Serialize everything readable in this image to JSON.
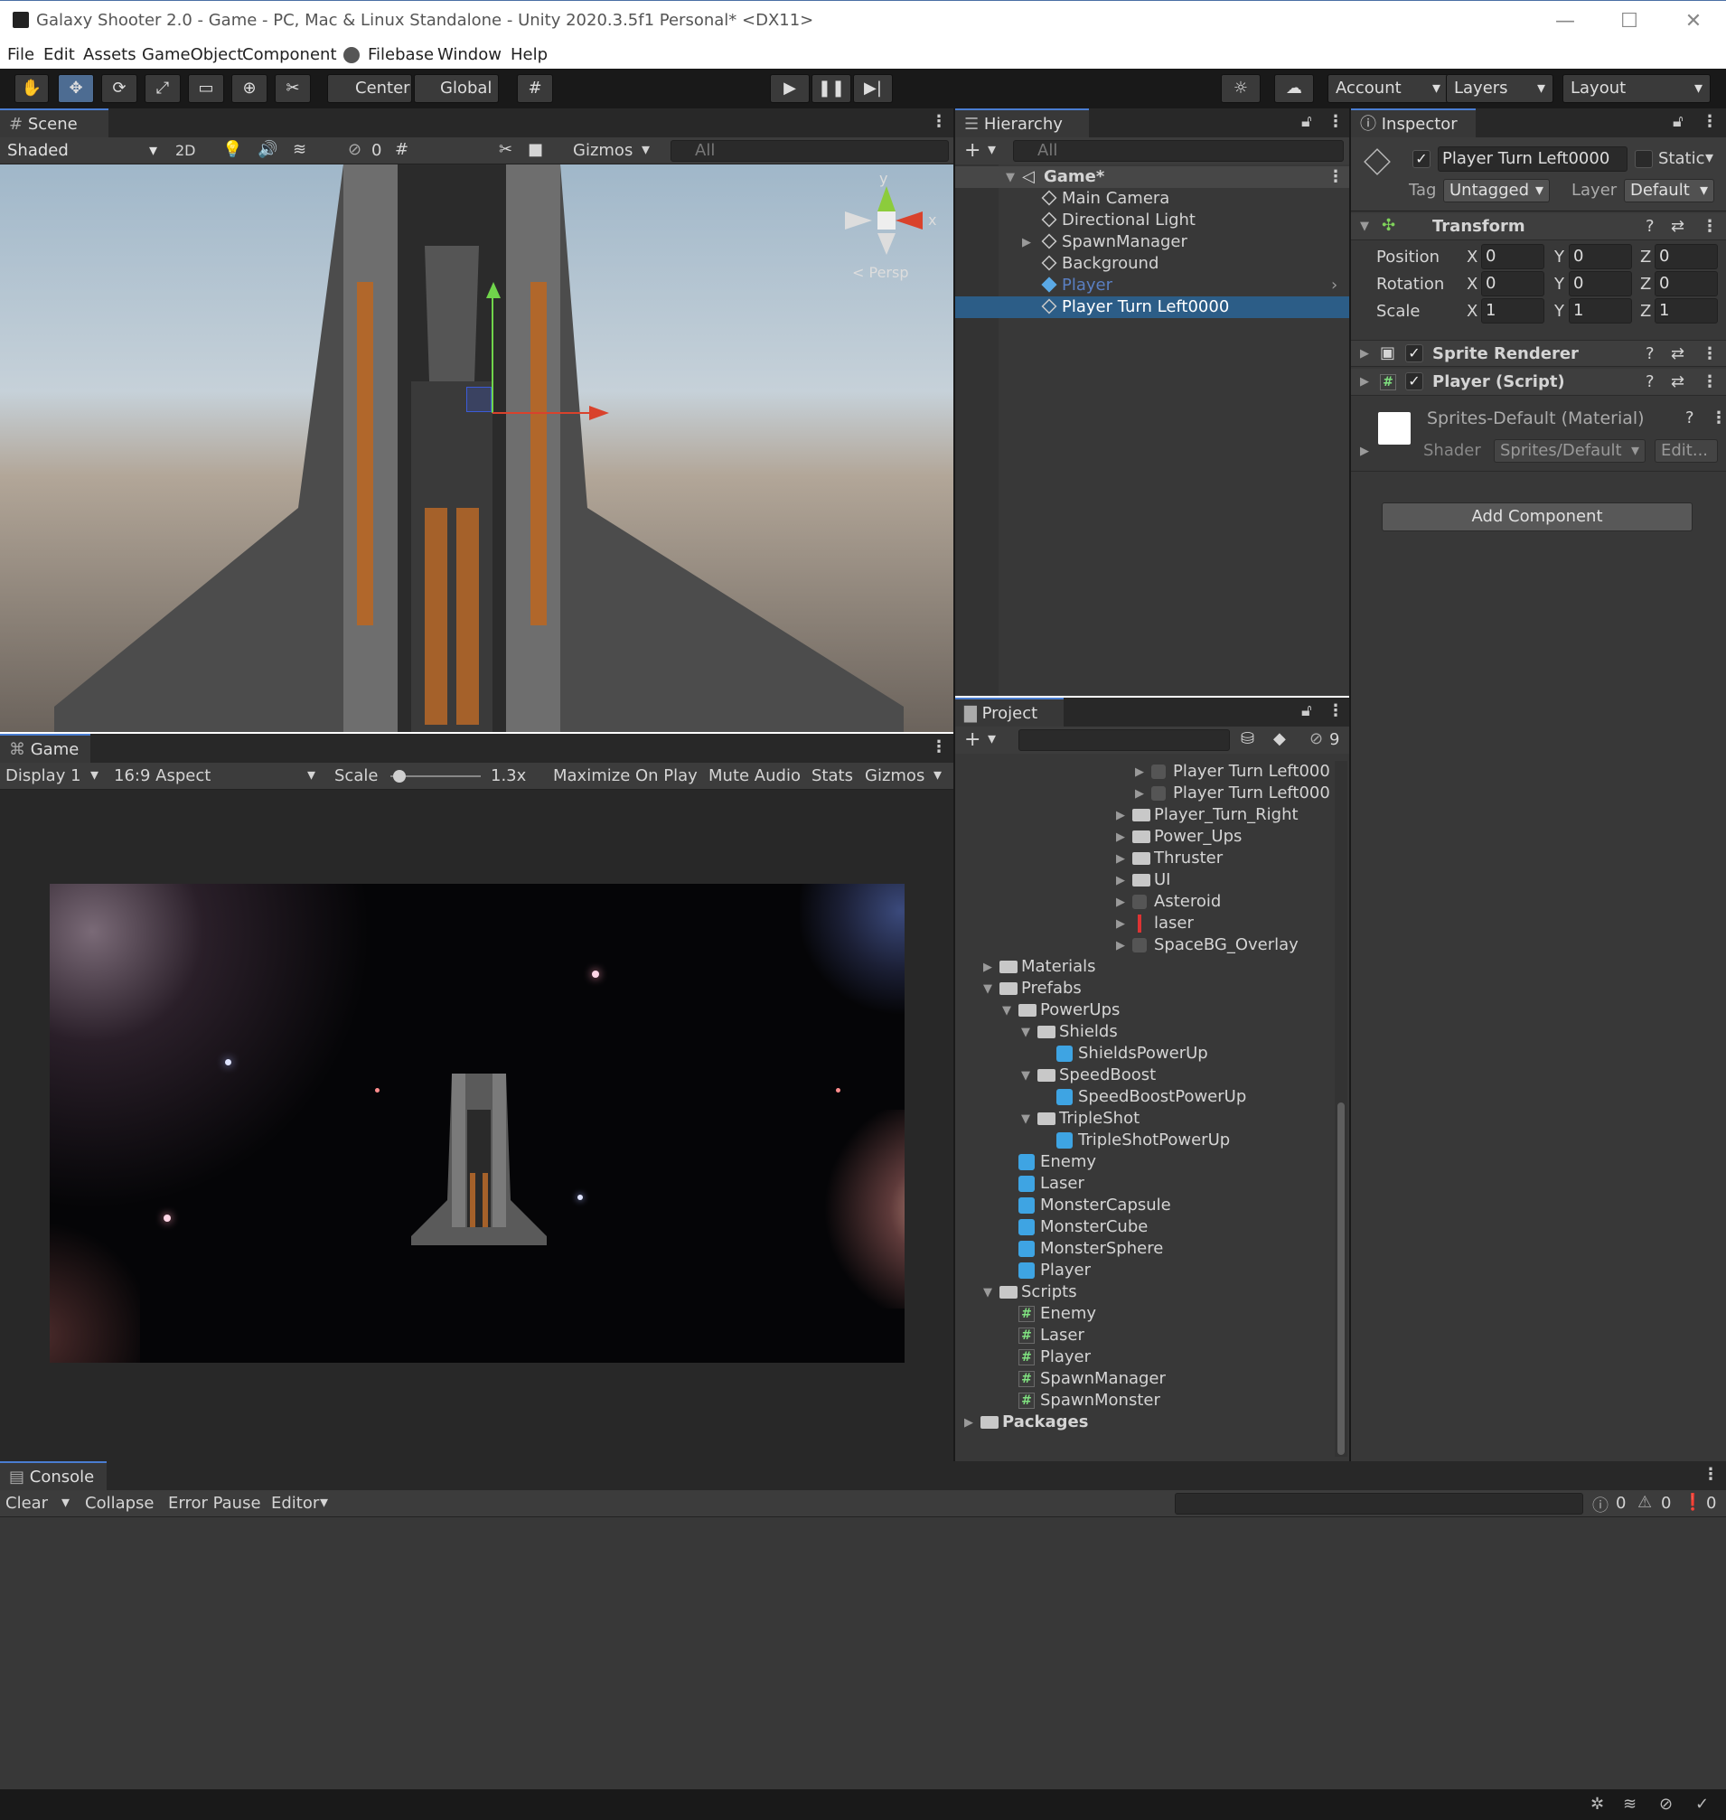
{
  "window": {
    "title": "Galaxy Shooter 2.0 - Game - PC, Mac & Linux Standalone - Unity 2020.3.5f1 Personal* <DX11>",
    "minimize": "—",
    "maximize": "☐",
    "close": "✕"
  },
  "menu": [
    "File",
    "Edit",
    "Assets",
    "GameObject",
    "Component",
    "Filebase",
    "Window",
    "Help"
  ],
  "toolbar": {
    "pivot": "Center",
    "space": "Global",
    "account": "Account",
    "layers": "Layers",
    "layout": "Layout"
  },
  "scene": {
    "tab": "Scene",
    "shading": "Shaded",
    "mode2d": "2D",
    "hidden_count": "0",
    "gizmos": "Gizmos",
    "search_placeholder": "All",
    "persp": "Persp",
    "axis_x": "x",
    "axis_y": "y"
  },
  "game": {
    "tab": "Game",
    "display": "Display 1",
    "aspect": "16:9 Aspect",
    "scale_label": "Scale",
    "scale_value": "1.3x",
    "scale_level": 0.1,
    "maximize": "Maximize On Play",
    "mute": "Mute Audio",
    "stats": "Stats",
    "gizmos": "Gizmos"
  },
  "hierarchy": {
    "tab": "Hierarchy",
    "search_placeholder": "All",
    "scene_name": "Game*",
    "items": [
      {
        "label": "Main Camera",
        "type": "object",
        "expandable": false
      },
      {
        "label": "Directional Light",
        "type": "object",
        "expandable": false
      },
      {
        "label": "SpawnManager",
        "type": "object",
        "expandable": true
      },
      {
        "label": "Background",
        "type": "object",
        "expandable": false
      },
      {
        "label": "Player",
        "type": "prefab",
        "expandable": false
      },
      {
        "label": "Player Turn Left0000",
        "type": "object",
        "expandable": false,
        "selected": true
      }
    ]
  },
  "project": {
    "tab": "Project",
    "hidden_count": "9",
    "items": [
      {
        "label": "Player Turn Left000",
        "indent": 9,
        "kind": "sprite",
        "arrow": "right"
      },
      {
        "label": "Player Turn Left000",
        "indent": 9,
        "kind": "sprite",
        "arrow": "right"
      },
      {
        "label": "Player_Turn_Right",
        "indent": 8,
        "kind": "folder",
        "arrow": "right"
      },
      {
        "label": "Power_Ups",
        "indent": 8,
        "kind": "folder",
        "arrow": "right"
      },
      {
        "label": "Thruster",
        "indent": 8,
        "kind": "folder",
        "arrow": "right"
      },
      {
        "label": "UI",
        "indent": 8,
        "kind": "folder",
        "arrow": "right"
      },
      {
        "label": "Asteroid",
        "indent": 8,
        "kind": "sprite",
        "arrow": "right"
      },
      {
        "label": "laser",
        "indent": 8,
        "kind": "laser",
        "arrow": "right"
      },
      {
        "label": "SpaceBG_Overlay",
        "indent": 8,
        "kind": "sprite",
        "arrow": "right"
      },
      {
        "label": "Materials",
        "indent": 1,
        "kind": "folder",
        "arrow": "right"
      },
      {
        "label": "Prefabs",
        "indent": 1,
        "kind": "folder",
        "arrow": "down"
      },
      {
        "label": "PowerUps",
        "indent": 2,
        "kind": "folder",
        "arrow": "down"
      },
      {
        "label": "Shields",
        "indent": 3,
        "kind": "folder",
        "arrow": "down"
      },
      {
        "label": "ShieldsPowerUp",
        "indent": 4,
        "kind": "prefab",
        "arrow": ""
      },
      {
        "label": "SpeedBoost",
        "indent": 3,
        "kind": "folder",
        "arrow": "down"
      },
      {
        "label": "SpeedBoostPowerUp",
        "indent": 4,
        "kind": "prefab",
        "arrow": ""
      },
      {
        "label": "TripleShot",
        "indent": 3,
        "kind": "folder",
        "arrow": "down"
      },
      {
        "label": "TripleShotPowerUp",
        "indent": 4,
        "kind": "prefab",
        "arrow": ""
      },
      {
        "label": "Enemy",
        "indent": 2,
        "kind": "prefab",
        "arrow": ""
      },
      {
        "label": "Laser",
        "indent": 2,
        "kind": "prefab",
        "arrow": ""
      },
      {
        "label": "MonsterCapsule",
        "indent": 2,
        "kind": "prefab",
        "arrow": ""
      },
      {
        "label": "MonsterCube",
        "indent": 2,
        "kind": "prefab",
        "arrow": ""
      },
      {
        "label": "MonsterSphere",
        "indent": 2,
        "kind": "prefab",
        "arrow": ""
      },
      {
        "label": "Player",
        "indent": 2,
        "kind": "prefab",
        "arrow": ""
      },
      {
        "label": "Scripts",
        "indent": 1,
        "kind": "folder",
        "arrow": "down"
      },
      {
        "label": "Enemy",
        "indent": 2,
        "kind": "script",
        "arrow": ""
      },
      {
        "label": "Laser",
        "indent": 2,
        "kind": "script",
        "arrow": ""
      },
      {
        "label": "Player",
        "indent": 2,
        "kind": "script",
        "arrow": ""
      },
      {
        "label": "SpawnManager",
        "indent": 2,
        "kind": "script",
        "arrow": ""
      },
      {
        "label": "SpawnMonster",
        "indent": 2,
        "kind": "script",
        "arrow": ""
      },
      {
        "label": "Packages",
        "indent": 0,
        "kind": "folder",
        "arrow": "right",
        "bold": true
      }
    ]
  },
  "inspector": {
    "tab": "Inspector",
    "object_name": "Player Turn Left0000",
    "static_label": "Static",
    "tag_label": "Tag",
    "tag_value": "Untagged",
    "layer_label": "Layer",
    "layer_value": "Default",
    "transform": {
      "title": "Transform",
      "position": {
        "label": "Position",
        "x": "0",
        "y": "0",
        "z": "0"
      },
      "rotation": {
        "label": "Rotation",
        "x": "0",
        "y": "0",
        "z": "0"
      },
      "scale": {
        "label": "Scale",
        "x": "1",
        "y": "1",
        "z": "1"
      }
    },
    "sprite_renderer": "Sprite Renderer",
    "player_script": "Player (Script)",
    "material_name": "Sprites-Default (Material)",
    "shader_label": "Shader",
    "shader_value": "Sprites/Default",
    "edit_button": "Edit...",
    "add_component": "Add Component"
  },
  "console": {
    "tab": "Console",
    "clear": "Clear",
    "collapse": "Collapse",
    "error_pause": "Error Pause",
    "editor": "Editor",
    "log_count": "0",
    "warn_count": "0",
    "error_count": "0"
  },
  "colors": {
    "selection": "#2c5d87",
    "panel": "#383838",
    "toolbar": "#191919",
    "accent_tab": "#4a7dd1"
  }
}
